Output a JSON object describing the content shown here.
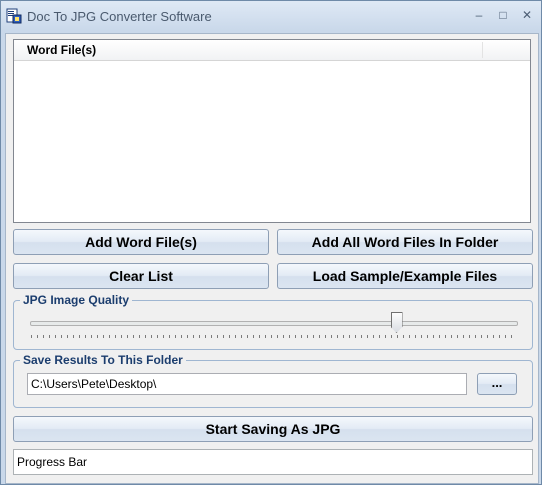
{
  "window": {
    "title": "Doc To JPG Converter Software",
    "minimize_glyph": "–",
    "maximize_glyph": "□",
    "close_glyph": "✕"
  },
  "file_list": {
    "column_header": "Word File(s)",
    "items": []
  },
  "buttons": {
    "add_files": "Add Word File(s)",
    "add_folder": "Add All Word Files In Folder",
    "clear_list": "Clear List",
    "load_sample": "Load Sample/Example Files",
    "start": "Start Saving As JPG",
    "browse": "..."
  },
  "quality": {
    "label": "JPG Image Quality",
    "value_fraction": 0.75
  },
  "output": {
    "label": "Save Results To This Folder",
    "folder": "C:\\Users\\Pete\\Desktop\\"
  },
  "progress": {
    "label": "Progress Bar"
  }
}
